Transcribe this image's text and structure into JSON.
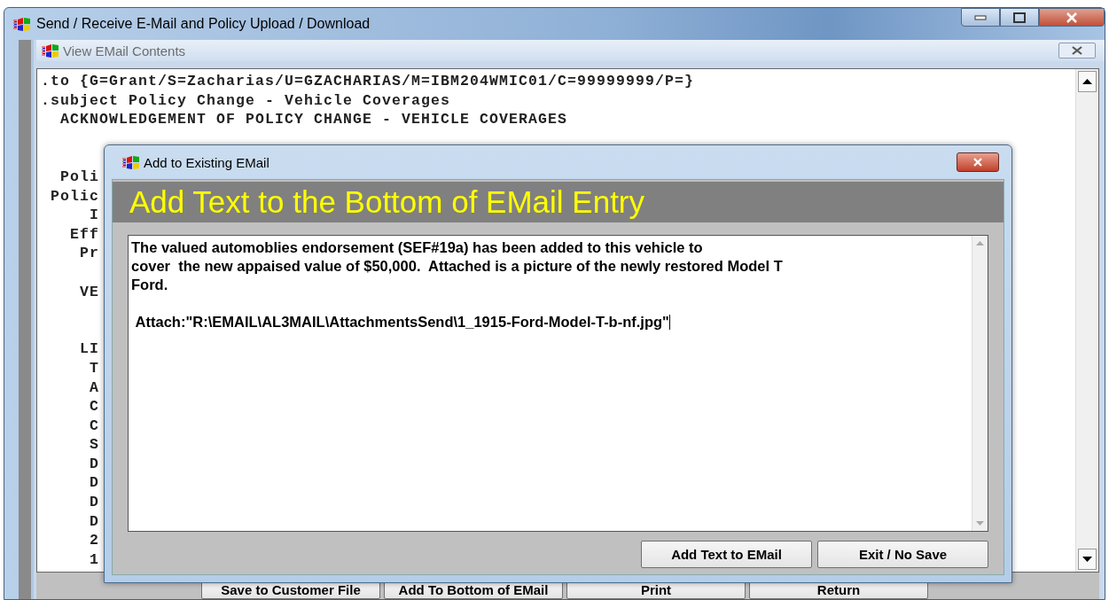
{
  "window": {
    "title": "Send / Receive E-Mail and Policy Upload / Download"
  },
  "email_view": {
    "title": "View EMail Contents",
    "content": ".to {G=Grant/S=Zacharias/U=GZACHARIAS/M=IBM204WMIC01/C=99999999/P=}\n.subject Policy Change - Vehicle Coverages\n  ACKNOWLEDGEMENT OF POLICY CHANGE - VEHICLE COVERAGES\n\n\n  Poli\n Polic\n     I\n   Eff\n    Pr\n\n    VE\n\n\n    LI\n     T\n     A\n     C\n     C\n     S\n     D\n     D\n     D\n     D\n     2\n     1",
    "buttons": [
      "Save to Customer File",
      "Add To Bottom of EMail",
      "Print",
      "Return"
    ]
  },
  "dialog": {
    "title": "Add to Existing EMail",
    "heading": "Add Text to the Bottom of EMail Entry",
    "text_paragraphs": [
      "The valued automoblies endorsement (SEF#19a) has been added to this vehicle to\ncover  the new appaised value of $50,000.  Attached is a picture of the newly restored Model T\nFord.",
      " Attach:\"R:\\EMAIL\\AL3MAIL\\AttachmentsSend\\1_1915-Ford-Model-T-b-nf.jpg\""
    ],
    "buttons": [
      "Add Text to EMail",
      "Exit / No Save"
    ]
  }
}
